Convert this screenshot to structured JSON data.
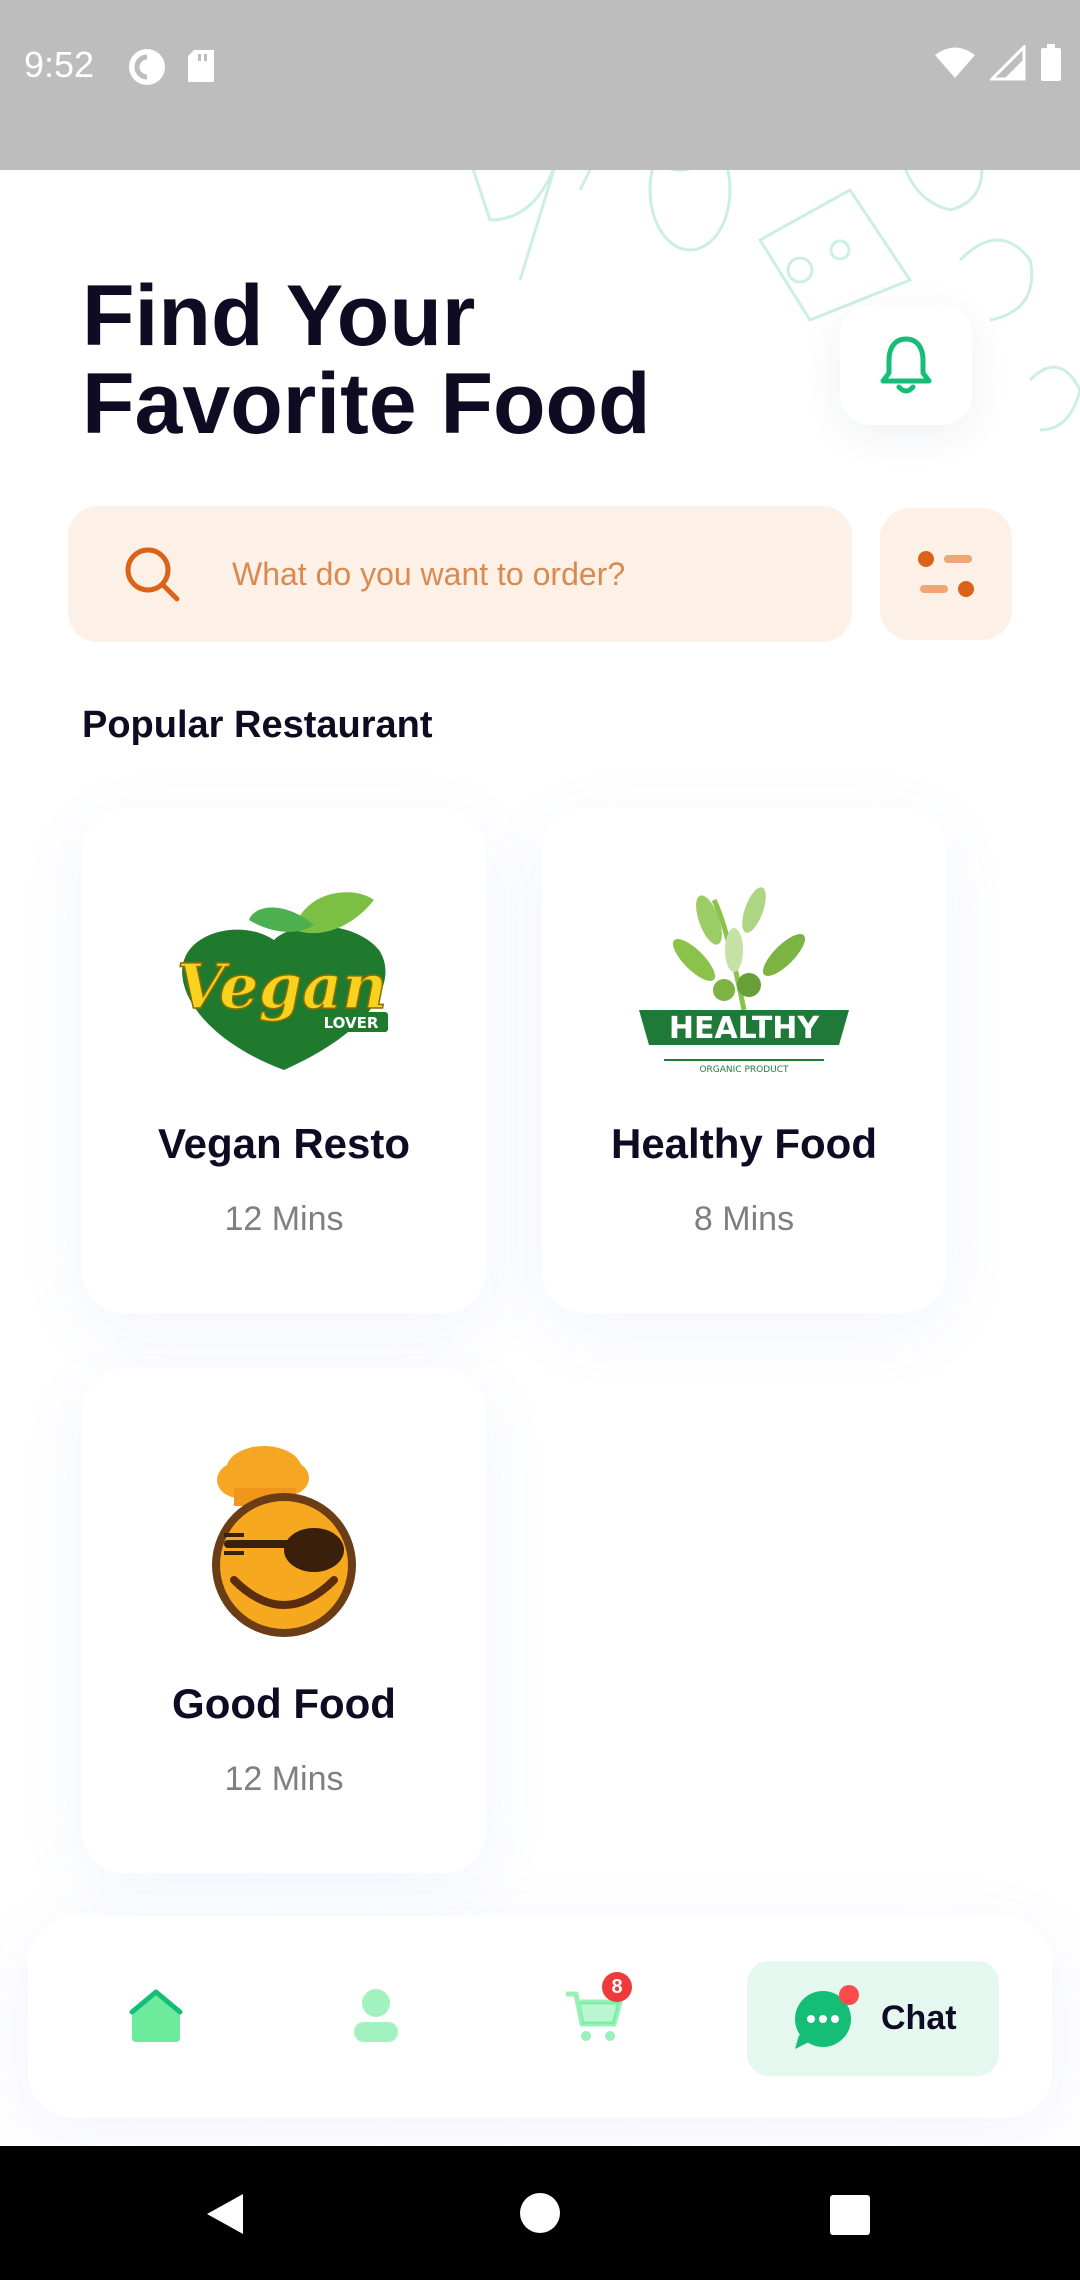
{
  "status_bar": {
    "time": "9:52",
    "icons_left": [
      "pocket-casts-icon",
      "sd-card-icon"
    ],
    "icons_right": [
      "wifi-icon",
      "cell-signal-icon",
      "battery-icon"
    ]
  },
  "header": {
    "title_line1": "Find Your",
    "title_line2": "Favorite Food",
    "notification_icon": "bell-icon"
  },
  "search": {
    "placeholder": "What do you want to order?",
    "icon": "search-icon",
    "filter_icon": "filter-icon"
  },
  "section": {
    "title": "Popular Restaurant"
  },
  "restaurants": [
    {
      "name": "Vegan Resto",
      "time": "12 Mins",
      "logo": "vegan-lover-logo",
      "logo_text": "Vegan",
      "logo_subtext": "LOVER"
    },
    {
      "name": "Healthy Food",
      "time": "8 Mins",
      "logo": "healthy-organic-logo",
      "logo_text": "HEALTHY",
      "logo_subtext": "ORGANIC PRODUCT"
    },
    {
      "name": "Good Food",
      "time": "12 Mins",
      "logo": "chef-smiley-logo"
    }
  ],
  "bottom_nav": {
    "items": [
      "home-icon",
      "profile-icon",
      "cart-icon",
      "chat-icon"
    ],
    "cart_badge": "8",
    "chat_label": "Chat"
  },
  "colors": {
    "accent_orange": "#da6317",
    "accent_green": "#15be77",
    "search_bg": "#fdf0e6",
    "title": "#0e0b22"
  }
}
